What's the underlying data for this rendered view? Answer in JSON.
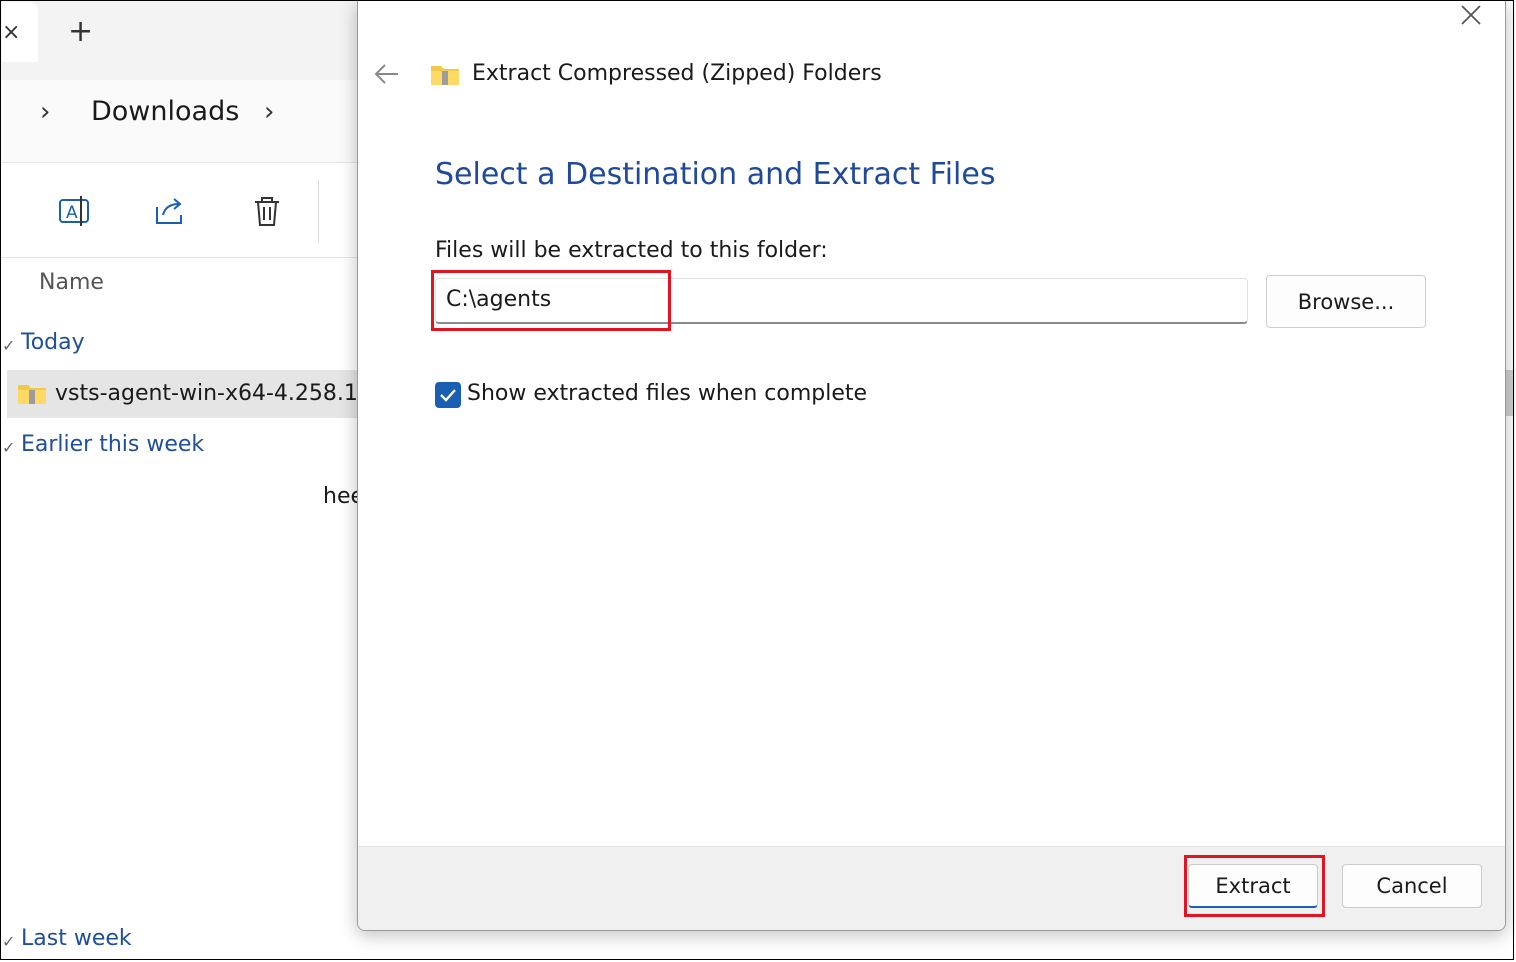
{
  "explorer": {
    "breadcrumb": "Downloads",
    "column_header": "Name",
    "groups": {
      "today": "Today",
      "earlier": "Earlier this week",
      "last_week": "Last week"
    },
    "selected_file": "vsts-agent-win-x64-4.258.1",
    "partial_text": "hee"
  },
  "dialog": {
    "window_title": "Extract Compressed (Zipped) Folders",
    "heading": "Select a Destination and Extract Files",
    "folder_label": "Files will be extracted to this folder:",
    "destination_path": "C:\\agents",
    "browse_label": "Browse...",
    "show_files_label": "Show extracted files when complete",
    "show_files_checked": true,
    "extract_label": "Extract",
    "cancel_label": "Cancel"
  },
  "colors": {
    "accent": "#1a5fb4",
    "heading": "#1f4a9c",
    "highlight": "#e3141f"
  }
}
